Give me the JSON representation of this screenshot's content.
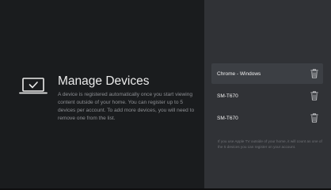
{
  "left": {
    "title": "Manage Devices",
    "description": "A device is registered automatically once you start viewing content outside of your home. You can register up to 5 devices per account. To add more devices, you will need to remove one from the list.",
    "icon": "laptop-checkmark-icon"
  },
  "devices": [
    {
      "name": "Chrome - Windows",
      "selected": true,
      "action_icon": "trash-icon"
    },
    {
      "name": "SM-T670",
      "selected": false,
      "action_icon": "trash-icon"
    },
    {
      "name": "SM-T670",
      "selected": false,
      "action_icon": "trash-icon"
    }
  ],
  "footer_note": "If you use Apple TV outside of your home, it will count as one of the 5 devices you can register on your account.",
  "colors": {
    "left_background": "#1a1c1e",
    "right_background": "#303236",
    "selected_row": "#3c3f44",
    "text_primary": "#ececec",
    "text_secondary": "#8d8f93"
  }
}
